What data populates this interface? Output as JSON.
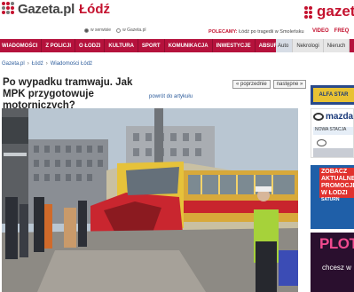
{
  "brand": {
    "logo_text": "Gazeta.pl",
    "city": "Łódź",
    "right_logo": "gazeta"
  },
  "search": {
    "option_site": "w serwisie",
    "option_gazeta": "w Gazeta.pl"
  },
  "polecamy": {
    "label": "POLECAMY:",
    "text": "Łódź po tragedii w Smoleńsku"
  },
  "top_links": [
    "VIDEO",
    "FREQ"
  ],
  "nav": {
    "items": [
      "WIADOMOŚCI",
      "Z POLICJI",
      "O ŁODZI",
      "KULTURA",
      "SPORT",
      "KOMUNIKACJA",
      "INWESTYCJE",
      "ABSURDY"
    ],
    "extra": [
      "Auto",
      "Nekrologi",
      "Nieruch"
    ]
  },
  "breadcrumb": [
    "Gazeta.pl",
    "Łódź",
    "Wiadomości Łódź"
  ],
  "article": {
    "title": "Po wypadku tramwaju. Jak MPK przygotowuje motorniczych?",
    "back_link": "powrót do artykułu",
    "prev_label": "« poprzednie",
    "next_label": "następne »"
  },
  "ads": {
    "ad1": "ALFA STAR",
    "ad2_brand": "mazda",
    "ad2_row": "NOWA STACJA",
    "ad3_headline": "ZOBACZ AKTUALNE PROMOCJE W ŁODZI",
    "ad3_sub": "SATURN",
    "ad4_title": "PLOT",
    "ad4_sub": "chcesz w"
  },
  "colors": {
    "brand_red": "#c4122f",
    "nav_bg": "#b5123c",
    "link_blue": "#2a5a9a"
  }
}
